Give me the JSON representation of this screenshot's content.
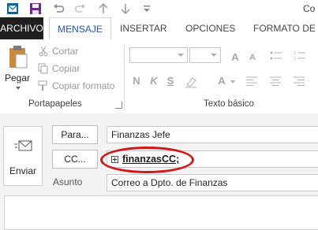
{
  "window": {
    "title": "Co"
  },
  "tabs": [
    {
      "label": "ARCHIVO"
    },
    {
      "label": "MENSAJE"
    },
    {
      "label": "INSERTAR"
    },
    {
      "label": "OPCIONES"
    },
    {
      "label": "FORMATO DE T"
    }
  ],
  "ribbon": {
    "clipboard": {
      "paste_label": "Pegar",
      "cut_label": "Cortar",
      "copy_label": "Copiar",
      "format_painter_label": "Copiar formato",
      "group_label": "Portapapeles"
    },
    "basic_text": {
      "group_label": "Texto básico",
      "bold": "N",
      "italic": "K",
      "underline": "S",
      "font_color": "A"
    }
  },
  "compose": {
    "send_label": "Enviar",
    "to_button": "Para...",
    "to_value": "Finanzas Jefe",
    "cc_button": "CC...",
    "cc_value": "finanzasCC;",
    "subject_label": "Asunto",
    "subject_value": "Correo a Dpto. de Finanzas"
  },
  "colors": {
    "accent": "#2b579a",
    "file_tab_bg": "#1f1f1f",
    "highlight": "#d01818"
  }
}
